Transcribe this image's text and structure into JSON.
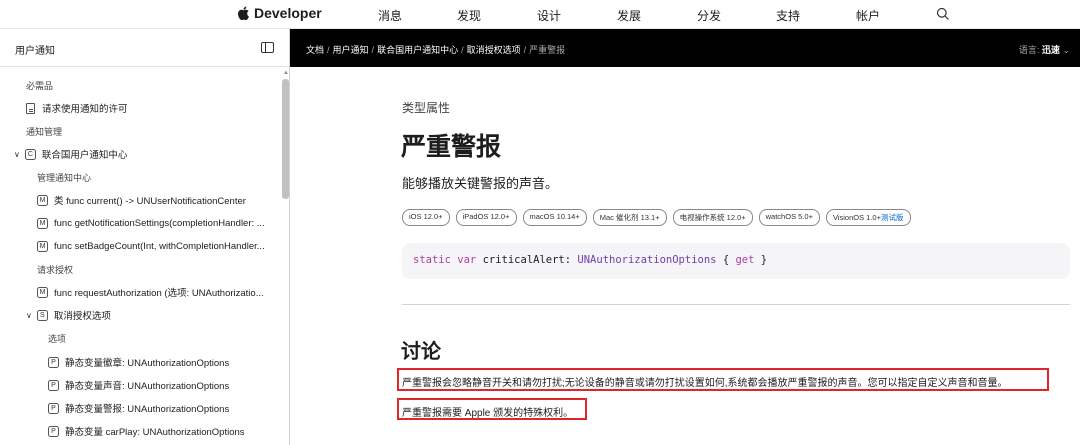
{
  "globalnav": {
    "brand": "Developer",
    "items": [
      "消息",
      "发现",
      "设计",
      "发展",
      "分发",
      "支持",
      "帐户"
    ]
  },
  "sidebar": {
    "title": "用户通知",
    "rows": [
      {
        "text": "必需品",
        "kind": "group"
      },
      {
        "text": "请求使用通知的许可",
        "kind": "doc"
      },
      {
        "text": "通知管理",
        "kind": "group"
      },
      {
        "text": "联合国用户通知中心",
        "kind": "class",
        "badge": "C"
      },
      {
        "text": "管理通知中心",
        "kind": "group"
      },
      {
        "text": "类 func current() -> UNUserNotificationCenter",
        "kind": "method",
        "badge": "M"
      },
      {
        "text": "func getNotificationSettings(completionHandler: ...",
        "kind": "method",
        "badge": "M"
      },
      {
        "text": "func setBadgeCount(Int, withCompletionHandler...",
        "kind": "method",
        "badge": "M"
      },
      {
        "text": "请求授权",
        "kind": "group"
      },
      {
        "text": "func requestAuthorization (选项: UNAuthorizatio...",
        "kind": "method",
        "badge": "M"
      },
      {
        "text": "取消授权选项",
        "kind": "struct",
        "badge": "S"
      },
      {
        "text": "选项",
        "kind": "group"
      },
      {
        "text": "静态变量徽章: UNAuthorizationOptions",
        "kind": "prop",
        "badge": "P"
      },
      {
        "text": "静态变量声音: UNAuthorizationOptions",
        "kind": "prop",
        "badge": "P"
      },
      {
        "text": "静态变量警报: UNAuthorizationOptions",
        "kind": "prop",
        "badge": "P"
      },
      {
        "text": "静态变量 carPlay: UNAuthorizationOptions",
        "kind": "prop",
        "badge": "P"
      }
    ]
  },
  "breadcrumb": {
    "items": [
      "文档",
      "用户通知",
      "联合国用户通知中心",
      "取消授权选项"
    ],
    "current": "严重警报"
  },
  "language": {
    "label": "语言:",
    "value": "迅速"
  },
  "content": {
    "eyebrow": "类型属性",
    "title": "严重警报",
    "abstract": "能够播放关键警报的声音。",
    "availability": [
      {
        "name": "iOS 12.0+"
      },
      {
        "name": "iPadOS 12.0+"
      },
      {
        "name": "macOS 10.14+"
      },
      {
        "name": "Mac 催化剂 13.1+"
      },
      {
        "name": "电视操作系统 12.0+"
      },
      {
        "name": "watchOS 5.0+"
      },
      {
        "name": "VisionOS 1.0+",
        "beta": "测试版"
      }
    ],
    "code": {
      "kw1": "static",
      "kw2": "var",
      "name": "criticalAlert:",
      "type": "UNAuthorizationOptions",
      "open": "{",
      "kw3": "get",
      "close": "}"
    },
    "discussion_title": "讨论",
    "paragraphs": [
      "严重警报会忽略静音开关和请勿打扰;无论设备的静音或请勿打扰设置如何,系统都会播放严重警报的声音。您可以指定自定义声音和音量。",
      "严重警报需要 Apple 颁发的特殊权利。"
    ]
  },
  "colors": {
    "highlight": "#e0252b",
    "keyword": "#ad3da4",
    "type": "#703daa"
  }
}
